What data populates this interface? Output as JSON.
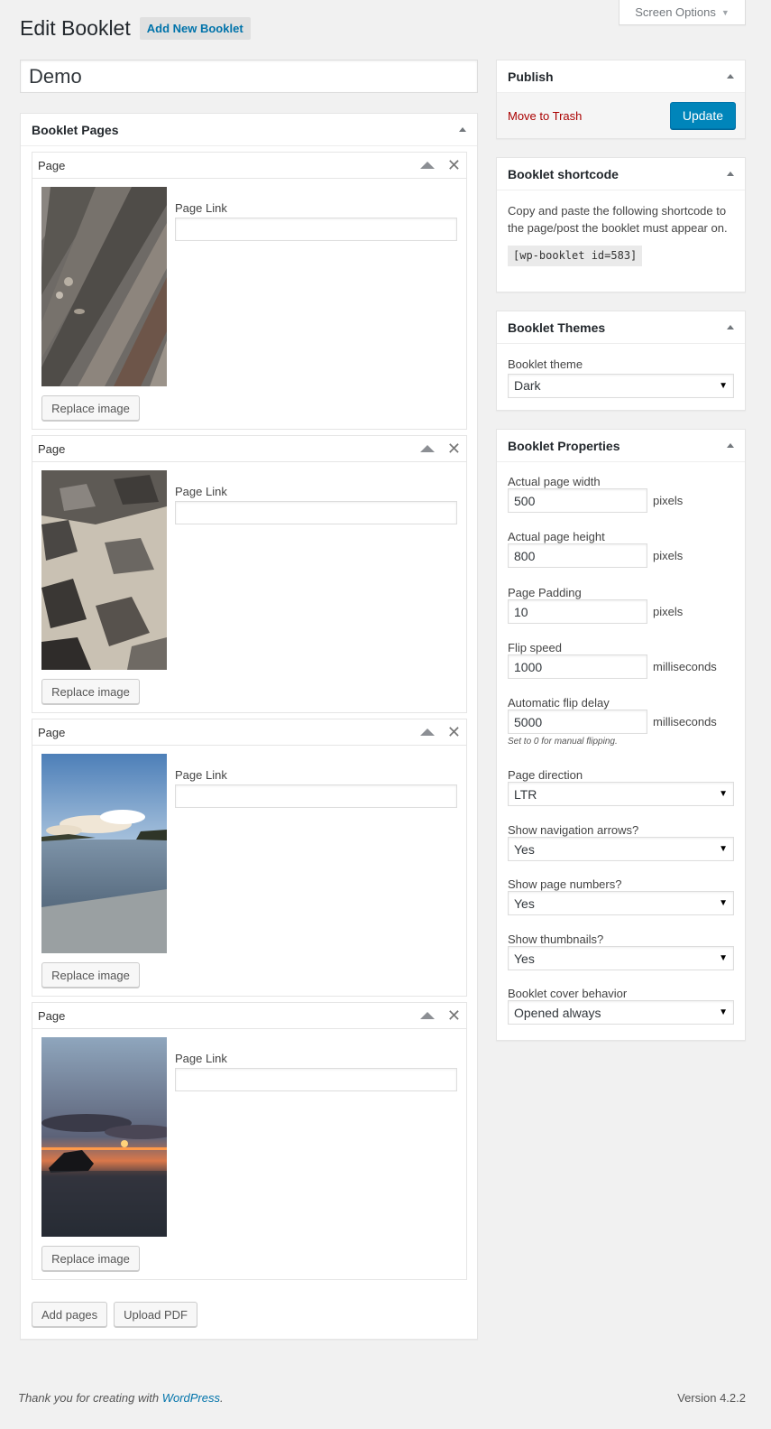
{
  "screen_options": {
    "label": "Screen Options"
  },
  "header": {
    "title": "Edit Booklet",
    "add_new": "Add New Booklet"
  },
  "title_field": {
    "value": "Demo"
  },
  "booklet_pages": {
    "title": "Booklet Pages",
    "page_header": "Page",
    "page_link_label": "Page Link",
    "replace_label": "Replace image",
    "pages": [
      {
        "label": "Page",
        "link": "",
        "image": "rocky-strata-photo"
      },
      {
        "label": "Page",
        "link": "",
        "image": "beach-rocks-photo"
      },
      {
        "label": "Page",
        "link": "",
        "image": "sea-clouds-photo"
      },
      {
        "label": "Page",
        "link": "",
        "image": "sunset-rock-photo"
      }
    ],
    "add_pages": "Add pages",
    "upload_pdf": "Upload PDF"
  },
  "publish": {
    "title": "Publish",
    "trash": "Move to Trash",
    "update": "Update"
  },
  "shortcode": {
    "title": "Booklet shortcode",
    "description": "Copy and paste the following shortcode to the page/post the booklet must appear on.",
    "code": "[wp-booklet id=583]"
  },
  "themes": {
    "title": "Booklet Themes",
    "label": "Booklet theme",
    "value": "Dark"
  },
  "properties": {
    "title": "Booklet Properties",
    "width": {
      "label": "Actual page width",
      "value": "500",
      "unit": "pixels"
    },
    "height": {
      "label": "Actual page height",
      "value": "800",
      "unit": "pixels"
    },
    "padding": {
      "label": "Page Padding",
      "value": "10",
      "unit": "pixels"
    },
    "speed": {
      "label": "Flip speed",
      "value": "1000",
      "unit": "milliseconds"
    },
    "delay": {
      "label": "Automatic flip delay",
      "value": "5000",
      "unit": "milliseconds",
      "hint": "Set to 0 for manual flipping."
    },
    "direction": {
      "label": "Page direction",
      "value": "LTR"
    },
    "arrows": {
      "label": "Show navigation arrows?",
      "value": "Yes"
    },
    "numbers": {
      "label": "Show page numbers?",
      "value": "Yes"
    },
    "thumbnails": {
      "label": "Show thumbnails?",
      "value": "Yes"
    },
    "cover": {
      "label": "Booklet cover behavior",
      "value": "Opened always"
    }
  },
  "footer": {
    "prefix": "Thank you for creating with ",
    "link": "WordPress",
    "suffix": ".",
    "version": "Version 4.2.2"
  },
  "colors": {
    "accent": "#0085ba",
    "link": "#0073aa",
    "danger": "#a00000"
  }
}
